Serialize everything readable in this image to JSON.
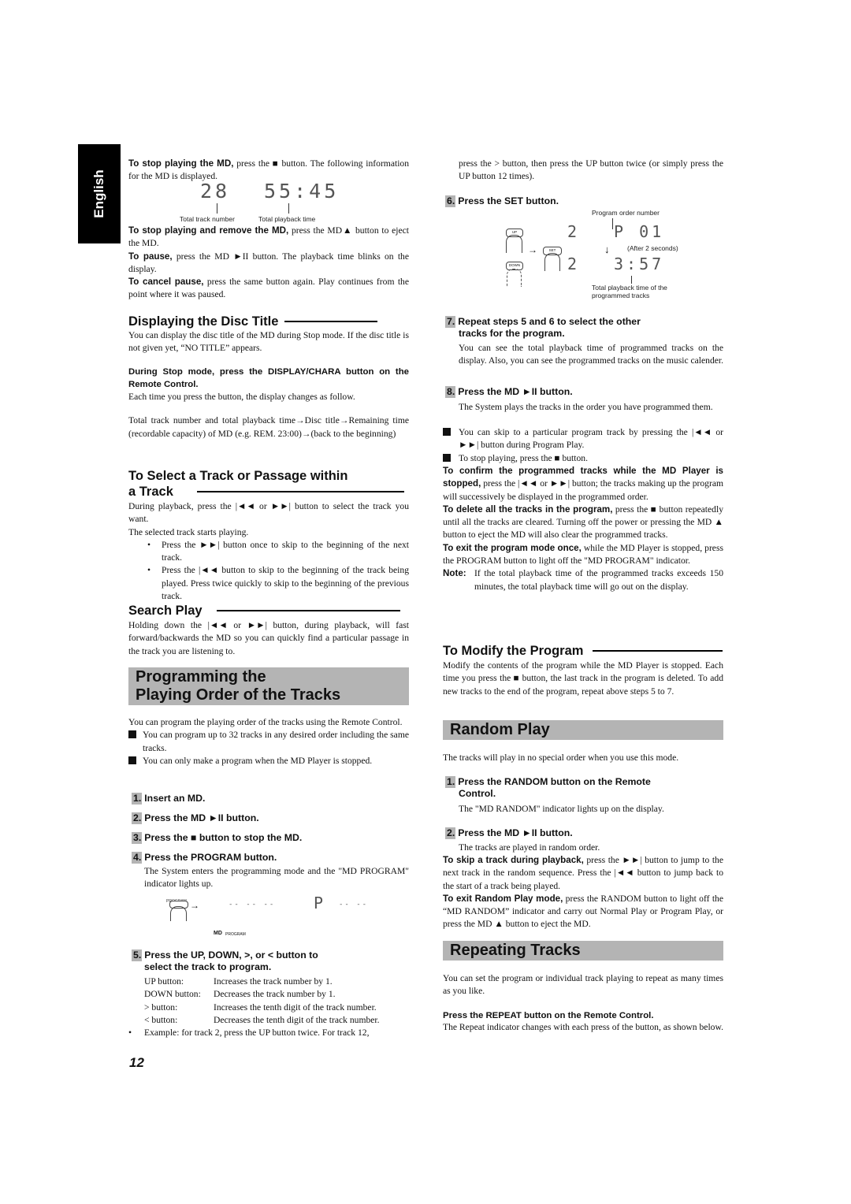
{
  "language_tab": "English",
  "page_number": "12",
  "left": {
    "stop": {
      "lead": "To stop playing the MD,",
      "text": " press the ■ button. The following information for the MD is displayed.",
      "display": {
        "track": "28",
        "time": "55:45"
      },
      "label_track": "Total track number",
      "label_time": "Total playback time"
    },
    "remove": {
      "lead": "To stop playing and remove the MD,",
      "text": " press the MD▲ button to eject the MD."
    },
    "pause": {
      "lead": "To pause,",
      "text": " press the MD ►II button. The playback time blinks on the display."
    },
    "cancel_pause": {
      "lead": "To cancel pause,",
      "text": " press the same button again. Play continues from the point where it was paused."
    },
    "disc_title": {
      "heading": "Displaying the Disc Title",
      "intro": "You can display the disc title of the MD during Stop mode. If the disc title is not given yet, “NO TITLE” appears.",
      "instruction": "During Stop mode, press the DISPLAY/CHARA button on the Remote Control.",
      "each_time": "Each time you press the button, the display changes as follow.",
      "sequence": "Total track number and total playback time→Disc title→Remaining time (recordable capacity) of MD (e.g. REM. 23:00)→(back to the beginning)"
    },
    "select_track": {
      "heading_line1": "To Select a Track or Passage within",
      "heading_line2": "a Track",
      "p1": "During playback, press the |◄◄ or ►►| button to select the track you want.",
      "p2": "The selected track starts playing.",
      "bullets": [
        "Press the ►►| button once to skip to the beginning of the next track.",
        "Press the |◄◄ button to skip to the beginning of the track being played. Press twice quickly to skip to the beginning of the previous track."
      ]
    },
    "search_play": {
      "heading": "Search Play",
      "text": "Holding down the |◄◄ or ►►| button, during playback, will fast forward/backwards the MD so you can quickly find a particular passage in the track you are listening to."
    },
    "programming": {
      "band_line1": "Programming the",
      "band_line2": "Playing Order of the Tracks",
      "intro": "You can program the playing order of the tracks using the Remote Control.",
      "notes": [
        "You can program up to 32 tracks in any desired order including the same tracks.",
        "You can only make a program when the MD Player is stopped."
      ],
      "steps": [
        {
          "num": "1.",
          "text": "Insert an MD."
        },
        {
          "num": "2.",
          "text": "Press the MD ►II button."
        },
        {
          "num": "3.",
          "text": "Press the ■ button to stop the MD."
        },
        {
          "num": "4.",
          "text": "Press the PROGRAM button."
        }
      ],
      "step4_desc": "The System enters the programming mode and the \"MD PROGRAM\" indicator lights up.",
      "program_btn_label": "PROGRAM",
      "display_before": "-- -- --",
      "display_after_p": "P",
      "display_after_dashes": "-- --",
      "indicator_md": "MD",
      "indicator_program": "PROGRAM",
      "step5": {
        "num": "5.",
        "line1": "Press the UP, DOWN, >, or < button to",
        "line2": "select the track to program."
      },
      "button_defs": [
        {
          "button": "UP button:",
          "desc": "Increases the track number by 1."
        },
        {
          "button": "DOWN button:",
          "desc": "Decreases the track number by 1."
        },
        {
          "button": ">  button:",
          "desc": "Increases the tenth digit of the track number."
        },
        {
          "button": "<  button:",
          "desc": "Decreases the tenth digit of the track number."
        }
      ],
      "example": "Example: for track 2, press the UP button twice. For track 12,"
    }
  },
  "right": {
    "example_cont": "press the > button, then press the UP button twice (or simply press the UP button 12 times).",
    "step6": {
      "num": "6.",
      "text": "Press the SET button."
    },
    "step6_fig": {
      "label_order": "Program order number",
      "up_label": "UP",
      "down_label": "DOWN",
      "set_label": "SET",
      "track1": "2",
      "prog": "P 01",
      "after": "(After 2 seconds)",
      "track2": "2",
      "time": "3:57",
      "label_total": "Total playback time of the programmed tracks"
    },
    "step7": {
      "num": "7.",
      "line1": "Repeat steps 5 and 6 to select the other",
      "line2": "tracks for the program.",
      "desc": "You can see the total playback time of programmed tracks on the display. Also, you can see the programmed tracks on the music calender."
    },
    "step8": {
      "num": "8.",
      "text": "Press the MD ►II button.",
      "desc": "The System plays the tracks in the order you have programmed them."
    },
    "step8_notes": [
      "You can skip to a particular program track by pressing the |◄◄ or ►►| button during Program Play.",
      "To stop playing, press the ■ button."
    ],
    "confirm": {
      "lead": "To confirm the programmed tracks while the MD Player is stopped,",
      "text": " press the |◄◄ or ►►| button; the tracks making up the program will successively be displayed in the programmed order."
    },
    "delete": {
      "lead": "To delete all the tracks in the program,",
      "text": " press the ■ button repeatedly until all the tracks are cleared. Turning off the power or pressing the MD ▲ button to eject the MD will also clear the programmed tracks."
    },
    "exit": {
      "lead": "To exit the program mode once,",
      "text": " while the MD Player is stopped, press the PROGRAM button to light off the \"MD PROGRAM\" indicator."
    },
    "note": {
      "label": "Note:",
      "text": "If the total playback time of the programmed tracks exceeds 150 minutes, the total playback time will go out on the display."
    },
    "modify": {
      "heading": "To Modify the Program",
      "text": "Modify the contents of the program while the MD Player is stopped. Each time you press the ■ button, the last track in the program is deleted. To add new tracks to the end of the program, repeat above steps 5 to 7."
    },
    "random": {
      "band": "Random Play",
      "intro": "The tracks will play in no special order when you use this mode.",
      "step1": {
        "num": "1.",
        "line1": "Press the RANDOM button on the Remote",
        "line2": "Control."
      },
      "step1_desc": "The \"MD RANDOM\" indicator lights up on the display.",
      "step2": {
        "num": "2.",
        "text": "Press the MD ►II button."
      },
      "step2_desc": "The tracks are played in random order.",
      "skip": {
        "lead": "To skip a track during playback,",
        "text": " press the ►►| button to jump to the next track in the random sequence. Press the |◄◄ button to jump back to the start of a track being played."
      },
      "exit": {
        "lead": "To exit Random Play mode,",
        "text": " press the RANDOM button to light off the “MD RANDOM” indicator and carry out Normal Play or Program Play, or press the MD ▲ button to eject the MD."
      }
    },
    "repeat": {
      "band": "Repeating Tracks",
      "intro": "You can set the program or individual track playing to repeat as many times as you like.",
      "instruction": "Press the REPEAT button on the Remote Control.",
      "desc": "The Repeat indicator changes with each press of the button, as shown below."
    }
  }
}
